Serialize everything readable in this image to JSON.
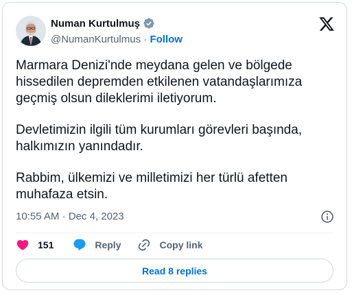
{
  "author": {
    "name": "Numan Kurtulmuş",
    "handle": "@NumanKurtulmus",
    "separator": "·",
    "follow_label": "Follow"
  },
  "tweet": {
    "paragraphs": [
      "Marmara Denizi'nde meydana gelen ve bölgede hissedilen depremden etkilenen vatandaşlarımıza geçmiş olsun dileklerimi iletiyorum.",
      "Devletimizin ilgili tüm kurumları görevleri başında, halkımızın yanındadır.",
      "Rabbim, ülkemizi ve milletimizi her türlü afetten muhafaza etsin."
    ],
    "time": "10:55 AM",
    "date": "Dec 4, 2023",
    "meta_separator": "·"
  },
  "actions": {
    "like_count": "151",
    "reply_label": "Reply",
    "copy_link_label": "Copy link"
  },
  "read_replies_label": "Read 8 replies",
  "colors": {
    "like": "#f91880",
    "reply_bubble": "#1d9bf0",
    "verified": "#829aab",
    "link": "#006fd6",
    "border": "#cfd9de"
  },
  "icons": {
    "verified": "verified-badge-icon",
    "logo": "x-logo-icon",
    "info": "info-icon",
    "like": "heart-icon",
    "reply": "speech-bubble-icon",
    "copy_link": "link-icon"
  }
}
